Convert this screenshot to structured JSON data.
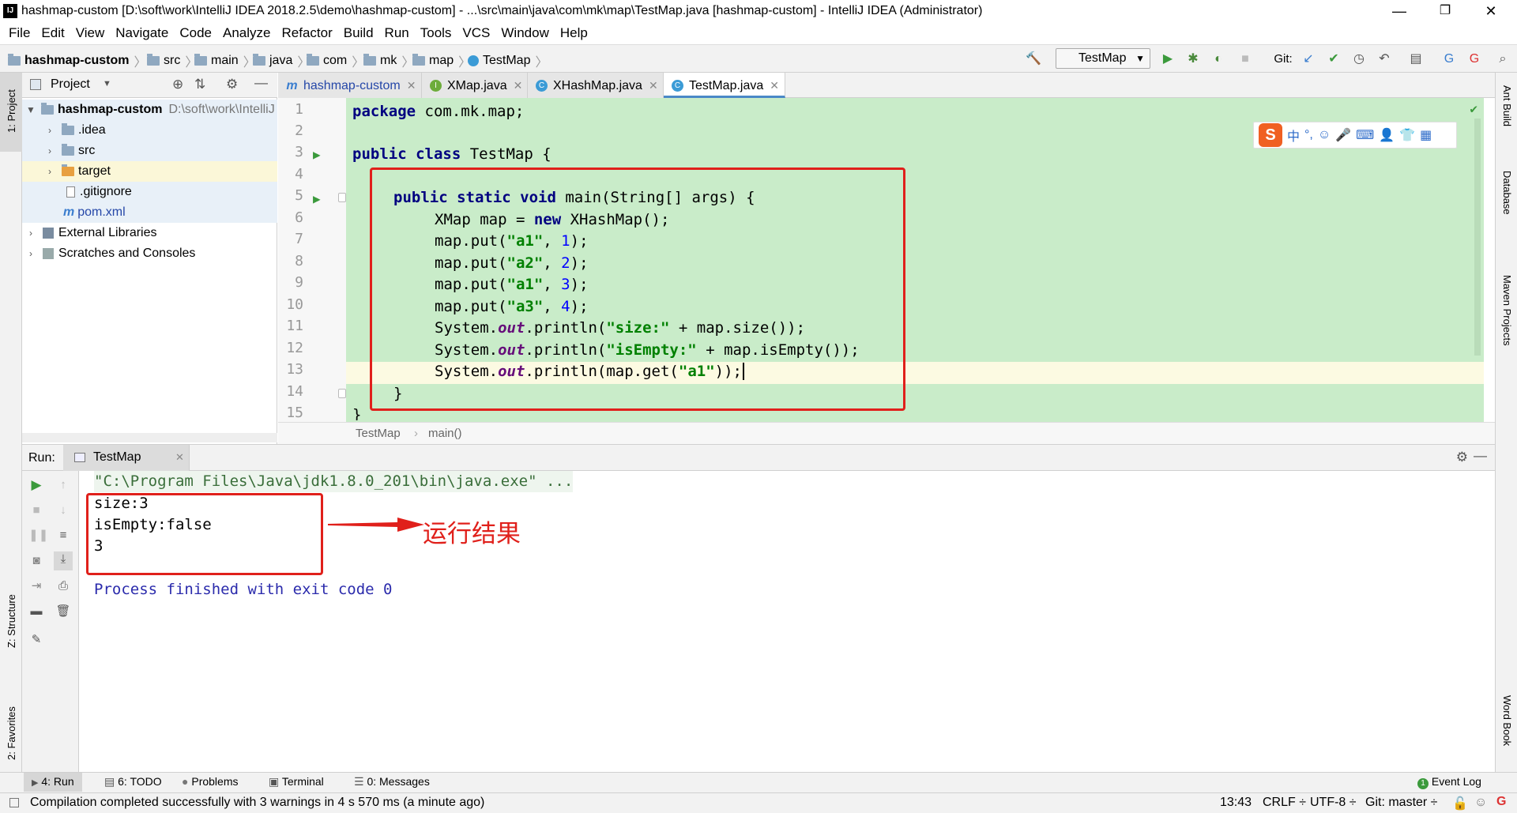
{
  "window": {
    "title": "hashmap-custom [D:\\soft\\work\\IntelliJ IDEA 2018.2.5\\demo\\hashmap-custom] - ...\\src\\main\\java\\com\\mk\\map\\TestMap.java [hashmap-custom] - IntelliJ IDEA (Administrator)",
    "minimize": "—",
    "restore": "❐",
    "close": "✕"
  },
  "menu": [
    "File",
    "Edit",
    "View",
    "Navigate",
    "Code",
    "Analyze",
    "Refactor",
    "Build",
    "Run",
    "Tools",
    "VCS",
    "Window",
    "Help"
  ],
  "breadcrumbs": [
    "hashmap-custom",
    "src",
    "main",
    "java",
    "com",
    "mk",
    "map",
    "TestMap"
  ],
  "toolbar": {
    "run_config": "TestMap",
    "git_label": "Git:"
  },
  "left_strip": {
    "project": "1: Project",
    "structure": "Z: Structure",
    "favorites": "2: Favorites"
  },
  "right_strip": {
    "ant": "Ant Build",
    "database": "Database",
    "maven": "Maven Projects",
    "wordbook": "Word Book"
  },
  "project_panel": {
    "title": "Project",
    "root_name": "hashmap-custom",
    "root_path": "D:\\soft\\work\\IntelliJ",
    "items": [
      ".idea",
      "src",
      "target",
      ".gitignore",
      "pom.xml",
      "External Libraries",
      "Scratches and Consoles"
    ]
  },
  "tabs": [
    "hashmap-custom",
    "XMap.java",
    "XHashMap.java",
    "TestMap.java"
  ],
  "tab_icons": [
    "m",
    "I",
    "C",
    "C"
  ],
  "code": {
    "line_numbers": [
      "1",
      "2",
      "3",
      "4",
      "5",
      "6",
      "7",
      "8",
      "9",
      "10",
      "11",
      "12",
      "13",
      "14",
      "15"
    ],
    "package_kw": "package",
    "package_name": " com.mk.map;",
    "class_kw": "public class",
    "class_name": " TestMap {",
    "main_kw": "public static void",
    "main_sig": " main(String[] args) {",
    "l6a": "XMap map = ",
    "l6kw": "new",
    "l6b": " XHashMap();",
    "put": "map.put(",
    "k1": "\"a1\"",
    "v1": "1",
    "k2": "\"a2\"",
    "v2": "2",
    "k3": "\"a1\"",
    "v3": "3",
    "k4": "\"a3\"",
    "v4": "4",
    "comma": ", ",
    "close": ");",
    "sys": "System.",
    "out": "out",
    "println": ".println(",
    "s_size": "\"size:\"",
    "size_tail": " + map.size());",
    "s_empty": "\"isEmpty:\"",
    "empty_tail": " + map.isEmpty());",
    "get_head": "map.get(",
    "get_key": "\"a1\"",
    "get_tail": "));",
    "brace1": "}",
    "brace2": "}"
  },
  "editor_breadcrumb": [
    "TestMap",
    "main()"
  ],
  "run_panel": {
    "label": "Run:",
    "tab": "TestMap",
    "cmd": "\"C:\\Program Files\\Java\\jdk1.8.0_201\\bin\\java.exe\" ...",
    "output": [
      "size:3",
      "isEmpty:false",
      "3"
    ],
    "finished": "Process finished with exit code 0",
    "annotation": "运行结果"
  },
  "bottom_tabs": [
    "4: Run",
    "6: TODO",
    "Problems",
    "Terminal",
    "0: Messages",
    "Event Log"
  ],
  "status": {
    "message": "Compilation completed successfully with 3 warnings in 4 s 570 ms (a minute ago)",
    "position": "13:43",
    "line_sep": "CRLF ÷",
    "encoding": "UTF-8 ÷",
    "git": "Git: master ÷"
  },
  "ime": {
    "symbols": [
      "中",
      "°,",
      "☺",
      "🎤",
      "⌨",
      "👤",
      "👕",
      "▦"
    ],
    "logo": "S"
  }
}
